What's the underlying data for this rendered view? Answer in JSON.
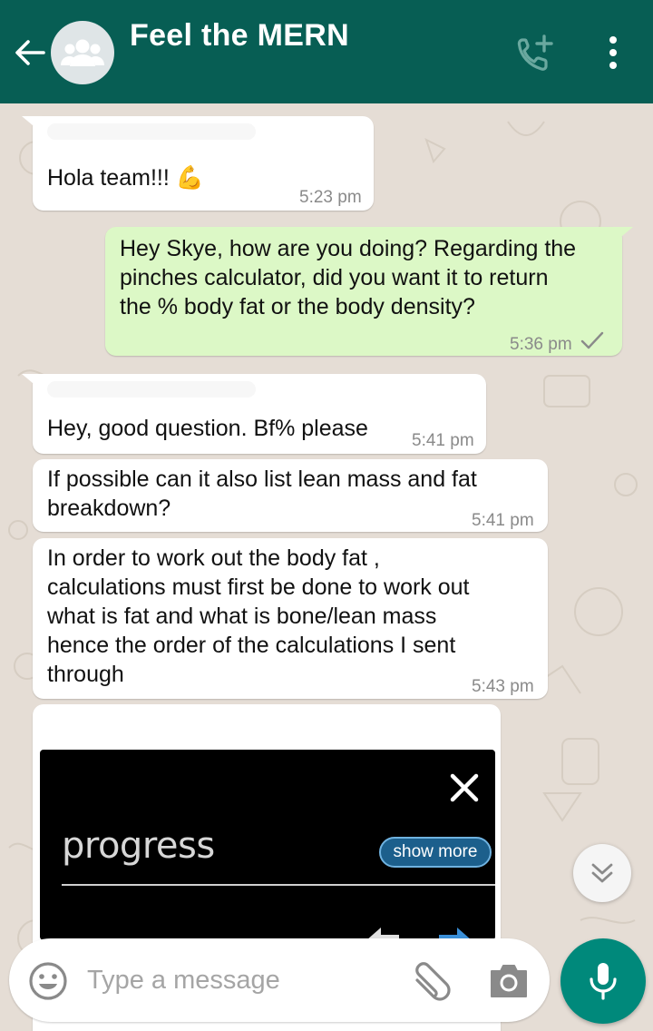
{
  "header": {
    "title": "Feel the MERN",
    "back_icon": "arrow-left-icon",
    "avatar_icon": "group-icon",
    "call_icon": "add-call-icon",
    "menu_icon": "more-vert-icon"
  },
  "colors": {
    "header_bg": "#075e54",
    "incoming_bubble": "#ffffff",
    "outgoing_bubble": "#dcf8c6",
    "chat_bg": "#e5ddd5",
    "fab": "#00897b"
  },
  "messages": [
    {
      "direction": "in",
      "text": "Hola team!!! ",
      "emoji": "💪",
      "time": "5:23 pm"
    },
    {
      "direction": "out",
      "text": "Hey Skye, how are you doing? Regarding the\npinches calculator, did you want it to return\nthe % body fat or the body density?",
      "time": "5:36 pm",
      "status_icon": "check-icon"
    },
    {
      "direction": "in",
      "text": "Hey, good question. Bf% please",
      "time": "5:41 pm"
    },
    {
      "direction": "in",
      "text": "If possible can it also list lean mass and fat\nbreakdown?",
      "time": "5:41 pm"
    },
    {
      "direction": "in",
      "text": "In order to work out the body fat ,\ncalculations must first be done to work out\nwhat is fat and what is bone/lean mass\nhence the order of the calculations I sent\nthrough",
      "time": "5:43 pm"
    }
  ],
  "image_message": {
    "label": "progress",
    "button": "show more",
    "close_icon": "close-icon",
    "nav_icons": "arrows-icon"
  },
  "input": {
    "placeholder": "Type a message",
    "value": "",
    "emoji_icon": "smiley-icon",
    "attach_icon": "paperclip-icon",
    "camera_icon": "camera-icon",
    "mic_icon": "microphone-icon"
  },
  "scroll_icon": "double-chevron-down-icon"
}
